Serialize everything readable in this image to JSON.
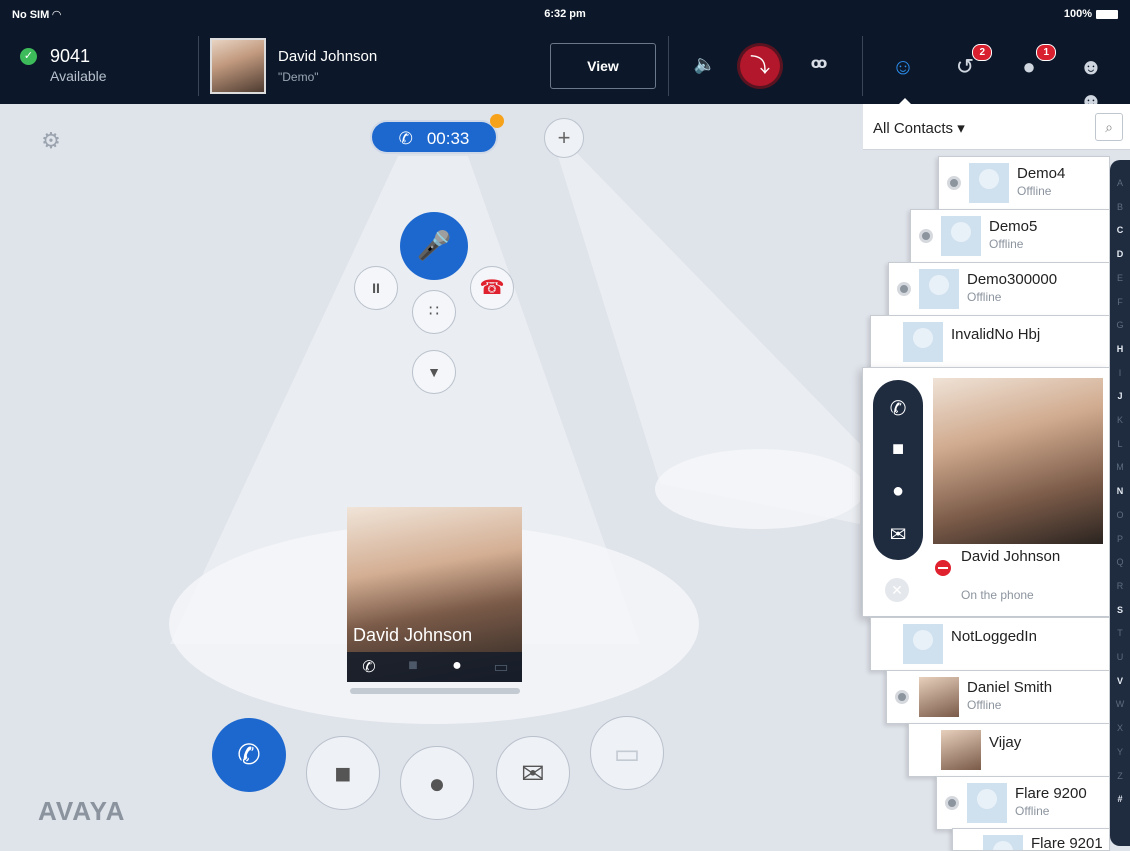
{
  "status_bar": {
    "carrier": "No SIM",
    "time": "6:32 pm",
    "battery": "100%"
  },
  "header": {
    "extension": "9041",
    "presence": "Available",
    "caller_name": "David Johnson",
    "caller_sub": "\"Demo\"",
    "view_label": "View",
    "history_badge": "2",
    "messages_badge": "1"
  },
  "call": {
    "timer": "00:33",
    "card_name": "David Johnson"
  },
  "brand": "AVAYA",
  "contacts": {
    "filter": "All Contacts ▾",
    "items": [
      {
        "name": "Demo4",
        "status": "Offline"
      },
      {
        "name": "Demo5",
        "status": "Offline"
      },
      {
        "name": "Demo300000",
        "status": "Offline"
      },
      {
        "name": "InvalidNo Hbj",
        "status": ""
      },
      {
        "name": "NotLoggedIn",
        "status": ""
      },
      {
        "name": "Daniel Smith",
        "status": "Offline"
      },
      {
        "name": "Vijay",
        "status": ""
      },
      {
        "name": "Flare 9200",
        "status": "Offline"
      },
      {
        "name": "Flare 9201",
        "status": ""
      }
    ],
    "expanded": {
      "name": "David Johnson",
      "status": "On the phone"
    }
  },
  "index_letters": [
    "A",
    "B",
    "C",
    "D",
    "E",
    "F",
    "G",
    "H",
    "I",
    "J",
    "K",
    "L",
    "M",
    "N",
    "O",
    "P",
    "Q",
    "R",
    "S",
    "T",
    "U",
    "V",
    "W",
    "X",
    "Y",
    "Z",
    "#"
  ],
  "index_active": [
    "C",
    "D",
    "H",
    "J",
    "N",
    "S",
    "V",
    "#"
  ],
  "icons": {
    "presence": "check-circle-icon",
    "speaker": "speaker-icon",
    "transfer": "transfer-icon",
    "voicemail": "voicemail-icon",
    "contacts": "person-icon",
    "history": "history-icon",
    "messages": "chat-icon",
    "groups": "group-icon",
    "settings": "gear-icon"
  },
  "colors": {
    "accent": "#1d68cf",
    "header_bg": "#0c1829",
    "end_call": "#e0222f",
    "timer_dot": "#f7a21b"
  }
}
